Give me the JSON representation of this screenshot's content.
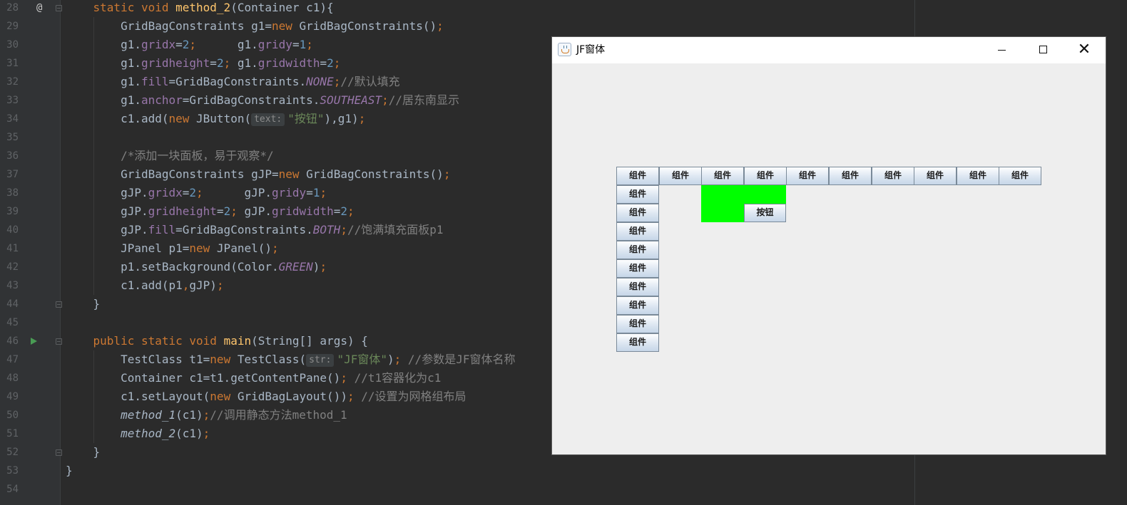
{
  "editor": {
    "line_numbers": [
      "28",
      "29",
      "30",
      "31",
      "32",
      "33",
      "34",
      "35",
      "36",
      "37",
      "38",
      "39",
      "40",
      "41",
      "42",
      "43",
      "44",
      "45",
      "46",
      "47",
      "48",
      "49",
      "50",
      "51",
      "52",
      "53",
      "54"
    ],
    "gutter_at": "@",
    "run_icon": "run-arrow-icon",
    "code_lines": [
      [
        {
          "t": "    "
        },
        {
          "t": "static void ",
          "c": "kw"
        },
        {
          "t": "method_2",
          "c": "fn"
        },
        {
          "t": "(Container c1){"
        }
      ],
      [
        {
          "t": "        GridBagConstraints g1="
        },
        {
          "t": "new ",
          "c": "kw"
        },
        {
          "t": "GridBagConstraints()"
        },
        {
          "t": ";",
          "c": "kw"
        }
      ],
      [
        {
          "t": "        g1."
        },
        {
          "t": "gridx",
          "c": "fd"
        },
        {
          "t": "="
        },
        {
          "t": "2",
          "c": "num"
        },
        {
          "t": ";",
          "c": "kw"
        },
        {
          "t": "      g1."
        },
        {
          "t": "gridy",
          "c": "fd"
        },
        {
          "t": "="
        },
        {
          "t": "1",
          "c": "num"
        },
        {
          "t": ";",
          "c": "kw"
        }
      ],
      [
        {
          "t": "        g1."
        },
        {
          "t": "gridheight",
          "c": "fd"
        },
        {
          "t": "="
        },
        {
          "t": "2",
          "c": "num"
        },
        {
          "t": ";",
          "c": "kw"
        },
        {
          "t": " g1."
        },
        {
          "t": "gridwidth",
          "c": "fd"
        },
        {
          "t": "="
        },
        {
          "t": "2",
          "c": "num"
        },
        {
          "t": ";",
          "c": "kw"
        }
      ],
      [
        {
          "t": "        g1."
        },
        {
          "t": "fill",
          "c": "fd"
        },
        {
          "t": "=GridBagConstraints."
        },
        {
          "t": "NONE",
          "c": "sf"
        },
        {
          "t": ";",
          "c": "kw"
        },
        {
          "t": "//默认填充",
          "c": "cm"
        }
      ],
      [
        {
          "t": "        g1."
        },
        {
          "t": "anchor",
          "c": "fd"
        },
        {
          "t": "=GridBagConstraints."
        },
        {
          "t": "SOUTHEAST",
          "c": "sf"
        },
        {
          "t": ";",
          "c": "kw"
        },
        {
          "t": "//居东南显示",
          "c": "cm"
        }
      ],
      [
        {
          "t": "        c1.add("
        },
        {
          "t": "new ",
          "c": "kw"
        },
        {
          "t": "JButton("
        },
        {
          "t": "text:",
          "c": "hint"
        },
        {
          "t": "\"按钮\"",
          "c": "str"
        },
        {
          "t": "),g1)"
        },
        {
          "t": ";",
          "c": "kw"
        }
      ],
      [],
      [
        {
          "t": "        "
        },
        {
          "t": "/*添加一块面板，易于观察*/",
          "c": "cm"
        }
      ],
      [
        {
          "t": "        GridBagConstraints gJP="
        },
        {
          "t": "new ",
          "c": "kw"
        },
        {
          "t": "GridBagConstraints()"
        },
        {
          "t": ";",
          "c": "kw"
        }
      ],
      [
        {
          "t": "        gJP."
        },
        {
          "t": "gridx",
          "c": "fd"
        },
        {
          "t": "="
        },
        {
          "t": "2",
          "c": "num"
        },
        {
          "t": ";",
          "c": "kw"
        },
        {
          "t": "      gJP."
        },
        {
          "t": "gridy",
          "c": "fd"
        },
        {
          "t": "="
        },
        {
          "t": "1",
          "c": "num"
        },
        {
          "t": ";",
          "c": "kw"
        }
      ],
      [
        {
          "t": "        gJP."
        },
        {
          "t": "gridheight",
          "c": "fd"
        },
        {
          "t": "="
        },
        {
          "t": "2",
          "c": "num"
        },
        {
          "t": ";",
          "c": "kw"
        },
        {
          "t": " gJP."
        },
        {
          "t": "gridwidth",
          "c": "fd"
        },
        {
          "t": "="
        },
        {
          "t": "2",
          "c": "num"
        },
        {
          "t": ";",
          "c": "kw"
        }
      ],
      [
        {
          "t": "        gJP."
        },
        {
          "t": "fill",
          "c": "fd"
        },
        {
          "t": "=GridBagConstraints."
        },
        {
          "t": "BOTH",
          "c": "sf"
        },
        {
          "t": ";",
          "c": "kw"
        },
        {
          "t": "//饱满填充面板p1",
          "c": "cm"
        }
      ],
      [
        {
          "t": "        JPanel p1="
        },
        {
          "t": "new ",
          "c": "kw"
        },
        {
          "t": "JPanel()"
        },
        {
          "t": ";",
          "c": "kw"
        }
      ],
      [
        {
          "t": "        p1.setBackground(Color."
        },
        {
          "t": "GREEN",
          "c": "sf"
        },
        {
          "t": ")"
        },
        {
          "t": ";",
          "c": "kw"
        }
      ],
      [
        {
          "t": "        c1.add(p1"
        },
        {
          "t": ",",
          "c": "kw"
        },
        {
          "t": "gJP)"
        },
        {
          "t": ";",
          "c": "kw"
        }
      ],
      [
        {
          "t": "    }"
        }
      ],
      [],
      [
        {
          "t": "    "
        },
        {
          "t": "public static void ",
          "c": "kw"
        },
        {
          "t": "main",
          "c": "fn"
        },
        {
          "t": "(String[] args) {"
        }
      ],
      [
        {
          "t": "        TestClass t1="
        },
        {
          "t": "new ",
          "c": "kw"
        },
        {
          "t": "TestClass("
        },
        {
          "t": "str:",
          "c": "hint"
        },
        {
          "t": "\"JF窗体\"",
          "c": "str"
        },
        {
          "t": ")"
        },
        {
          "t": "; ",
          "c": "kw"
        },
        {
          "t": "//参数是JF窗体名称",
          "c": "cm"
        }
      ],
      [
        {
          "t": "        Container c1=t1.getContentPane()"
        },
        {
          "t": "; ",
          "c": "kw"
        },
        {
          "t": "//t1容器化为c1",
          "c": "cm"
        }
      ],
      [
        {
          "t": "        c1.setLayout("
        },
        {
          "t": "new ",
          "c": "kw"
        },
        {
          "t": "GridBagLayout())"
        },
        {
          "t": "; ",
          "c": "kw"
        },
        {
          "t": "//设置为网格组布局",
          "c": "cm"
        }
      ],
      [
        {
          "t": "        "
        },
        {
          "t": "method_1",
          "c": "it"
        },
        {
          "t": "(c1)"
        },
        {
          "t": ";",
          "c": "kw"
        },
        {
          "t": "//调用静态方法method_1",
          "c": "cm"
        }
      ],
      [
        {
          "t": "        "
        },
        {
          "t": "method_2",
          "c": "it"
        },
        {
          "t": "(c1)"
        },
        {
          "t": ";",
          "c": "kw"
        }
      ],
      [
        {
          "t": "    }"
        }
      ],
      [
        {
          "t": "}"
        }
      ],
      []
    ]
  },
  "window": {
    "title": "JF窗体",
    "minimize_icon": "minimize-icon",
    "maximize_icon": "maximize-icon",
    "close_icon": "close-icon",
    "close_glyph": "✕",
    "component_label": "组件",
    "button_label": "按钮",
    "panel_color": "#00ff00",
    "top_row_count": 10,
    "left_column_count": 9
  },
  "colors": {
    "kw": "#cc7832",
    "fn": "#ffc66d",
    "fd": "#9876aa",
    "num": "#6897bb",
    "str": "#6a8759",
    "cm": "#808080",
    "sf": "#9876aa",
    "it": "#a9b7c6",
    "default": "#a9b7c6"
  }
}
